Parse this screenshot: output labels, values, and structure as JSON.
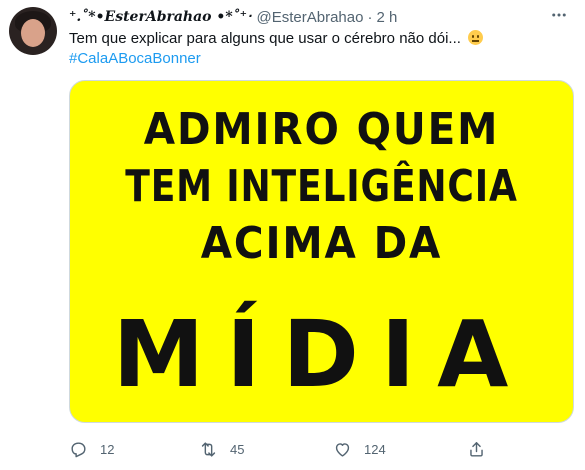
{
  "tweet": {
    "display_name": "⁺.˚*•𝑬𝒔𝒕𝒆𝒓𝑨𝒃𝒓𝒂𝒉𝒂𝒐 •*˚⁺‧",
    "handle": "@EsterAbrahao",
    "separator": "·",
    "time": "2 h",
    "more_icon": "ellipsis-icon",
    "text": "Tem que explicar para alguns que usar o cérebro não dói...",
    "emoji": "neutral-face-emoji",
    "hashtag": "#CalaABocaBonner"
  },
  "media": {
    "background_color": "#ffff00",
    "lines": [
      "ADMIRO QUEM",
      "TEM INTELIGÊNCIA",
      "ACIMA DA",
      "MÍDIA"
    ]
  },
  "actions": {
    "reply_count": "12",
    "retweet_count": "45",
    "like_count": "124"
  },
  "colors": {
    "link": "#1d9bf0",
    "secondary_text": "#536471"
  }
}
